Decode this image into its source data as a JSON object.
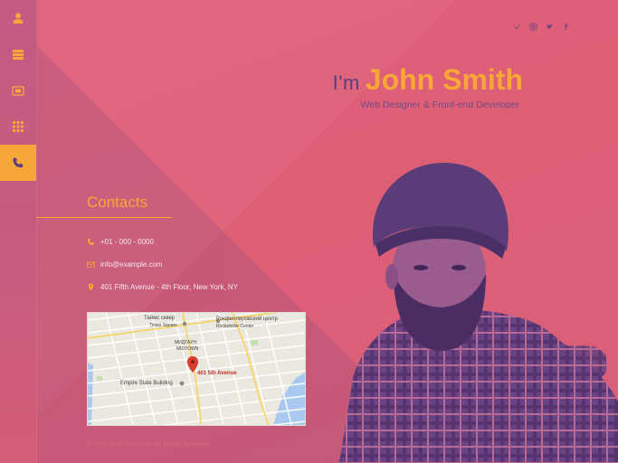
{
  "sidebar": {
    "items": [
      {
        "icon": "user-icon",
        "active": false
      },
      {
        "icon": "resume-icon",
        "active": false
      },
      {
        "icon": "portfolio-icon",
        "active": false
      },
      {
        "icon": "grid-icon",
        "active": false
      },
      {
        "icon": "phone-icon",
        "active": true
      }
    ]
  },
  "social": [
    "vimeo-icon",
    "instagram-icon",
    "twitter-icon",
    "facebook-icon"
  ],
  "header": {
    "prefix": "I'm",
    "name": "John Smith",
    "role": "Web Designer & Front-end Developer"
  },
  "contacts": {
    "title": "Contacts",
    "phone": "+01 - 000 - 0000",
    "email": "info@example.com",
    "address": "401 Fifth Avenue - 4th Floor, New York, NY"
  },
  "map": {
    "labels": {
      "square": "Таймс сквер",
      "square_sub": "Times Square",
      "center": "Рокфеллеровский центр",
      "center_sub": "Rockefeller Center",
      "midtown": "МИДТАУН",
      "midtown_sub": "MIDTOWN",
      "empire": "Empire State Building",
      "pin": "401 5th Avenue"
    }
  },
  "footer": "© 2017 John Smith Ltd. All Rights Reserved",
  "colors": {
    "accent": "#f7a638",
    "background": "#e05f7a",
    "sidebar": "#c55c80"
  }
}
